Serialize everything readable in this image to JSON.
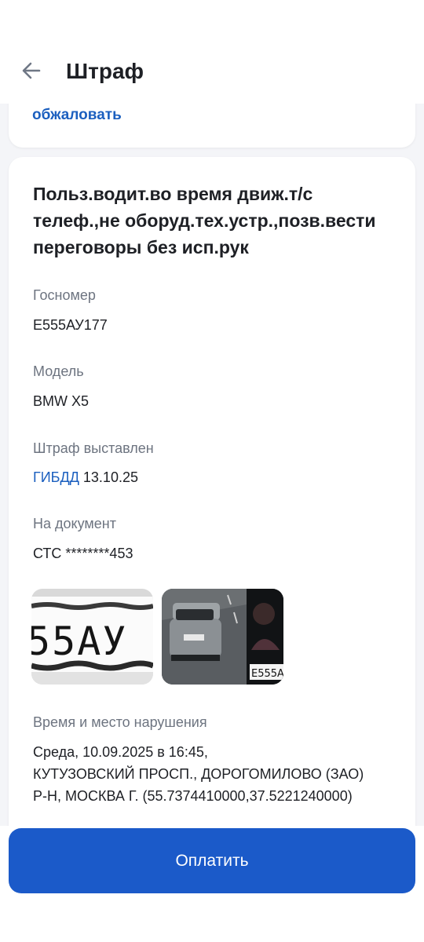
{
  "header": {
    "title": "Штраф"
  },
  "top_card": {
    "appeal_link": "обжаловать"
  },
  "fine": {
    "description": "Польз.водит.во время движ.т/с телеф.,не оборуд.тех.устр.,позв.вести переговоры без исп.рук",
    "plate_label": "Госномер",
    "plate_value": "Е555АУ177",
    "model_label": "Модель",
    "model_value": "BMW X5",
    "issued_label": "Штраф выставлен",
    "issued_by": "ГИБДД",
    "issued_date": "13.10.25",
    "document_label": "На документ",
    "document_value": "СТС ********453",
    "photos": {
      "plate_crop_text": "55АУ",
      "camera_plate_text": "Е555А"
    },
    "place_label": "Время и место нарушения",
    "place_line1": "Среда, 10.09.2025 в 16:45,",
    "place_line2": "КУТУЗОВСКИЙ ПРОСП., ДОРОГОМИЛОВО (ЗАО)",
    "place_line3": "Р-Н, МОСКВА Г. (55.7374410000,37.5221240000)"
  },
  "footer": {
    "pay_label": "Оплатить"
  },
  "colors": {
    "accent": "#1b5ac9",
    "link": "#1b5fbf",
    "background": "#f4f5f8"
  },
  "icons": {
    "back": "arrow-left-icon"
  }
}
